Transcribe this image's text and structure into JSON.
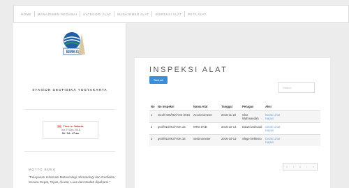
{
  "nav": {
    "items": [
      "HOME",
      "MANAJEMEN PEGAWAI",
      "KATEGORI ALAT",
      "MANAJEMEN ALAT",
      "INSPEKSI ALAT",
      "PETA ALAT"
    ]
  },
  "sidebar": {
    "logo_text": "BMKG",
    "station_name": "STASIUN GEOFISIKA YOGYAKARTA",
    "clock": {
      "timezone": "Time in Jakarta",
      "date": "Tue 27 Dec 2016",
      "time": "09 : 34 : 47 am"
    },
    "motto_title": "MOTTO BMKG",
    "motto_text": "\"Pelayanan Informasi Meteorologi, Klimatologi dan Geofisika Secara Cepat, Tepat, Akurat, Luas dan Mudah dipahami.\""
  },
  "main": {
    "title": "INSPEKSI ALAT",
    "add_button": "Tambah",
    "search_placeholder": "Search",
    "table": {
      "headers": [
        "No",
        "No Inspeksi",
        "Nama Alat",
        "Tanggal",
        "Petugas",
        "Aksi"
      ],
      "rows": [
        {
          "no": "1",
          "inspeksi": "Geof/ 025/05A/YGI-2016",
          "nama": "Accelerometer",
          "tanggal": "2016-11-22",
          "petugas": "Chic Wahmandah",
          "aksi_lihat": "Cetak Lihat",
          "aksi_hapus": "Hapus"
        },
        {
          "no": "2",
          "inspeksi": "geof/010/IK3/YGK 16",
          "nama": "WRS DVB",
          "tanggal": "2016-10-13",
          "petugas": "Dawid wahuudi",
          "aksi_lihat": "Cetak Lihat",
          "aksi_hapus": "Hapus"
        },
        {
          "no": "3",
          "inspeksi": "geof/010/IK3/YGK 16",
          "nama": "Seismometer",
          "tanggal": "2016-10-13",
          "petugas": "Slegel Wiliemo",
          "aksi_lihat": "Cetak Lihat",
          "aksi_hapus": "Hapus"
        }
      ]
    },
    "pagination": [
      "«",
      "‹",
      "1",
      "›",
      "»"
    ]
  },
  "colors": {
    "accent": "#3b8fd8",
    "link": "#6fa3d6"
  }
}
